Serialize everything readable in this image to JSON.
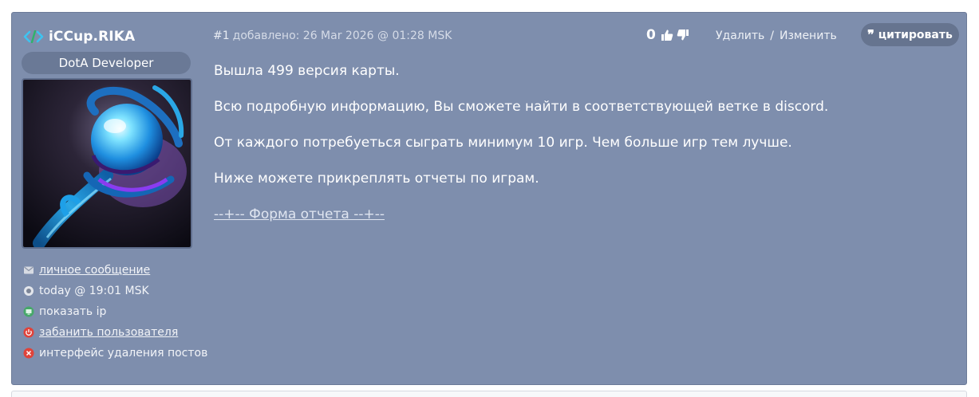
{
  "user": {
    "name": "iCCup.RIKA",
    "role": "DotA Developer",
    "links": [
      {
        "icon": "envelope-icon",
        "label": "личное сообщение",
        "link": true
      },
      {
        "icon": "clock-icon",
        "label": "today @ 19:01 MSK",
        "link": false
      },
      {
        "icon": "monitor-icon",
        "label": "показать ip",
        "link": false
      },
      {
        "icon": "power-icon",
        "label": "забанить пользователя",
        "link": true
      },
      {
        "icon": "delete-circle-icon",
        "label": "интерфейс удаления постов",
        "link": false
      }
    ]
  },
  "post": {
    "number": "#1",
    "added": "добавлено: 26 Mar 2026 @ 01:28 MSK",
    "votes": "0",
    "delete_label": "Удалить",
    "separator": "/",
    "edit_label": "Изменить",
    "quote_label": "цитировать",
    "paragraphs": [
      "Вышла 499 версия карты.",
      "Всю подробную информацию, Вы сможете найти в соответствующей ветке в discord.",
      "От каждого потребуеться сыграть минимум 10 игр. Чем больше игр тем лучше.",
      "Ниже можете прикреплять отчеты по играм."
    ],
    "form_link": "--+-- Форма отчета --+--"
  },
  "colors": {
    "post_bg": "#7e8ead",
    "badge_bg": "#6a7996",
    "code_icon": "#3ec3f0",
    "power_icon": "#e0433a"
  }
}
